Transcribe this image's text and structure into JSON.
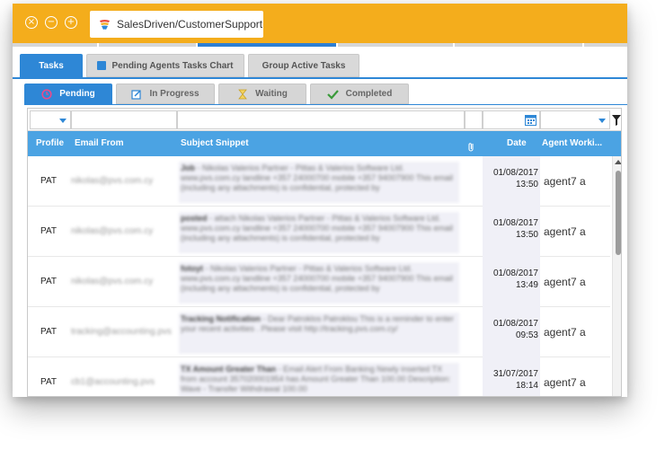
{
  "window": {
    "tab_title": "SalesDriven/CustomerSupport",
    "accent_color": "#f4ad1c",
    "controls": [
      "close-icon",
      "minimize-icon",
      "maximize-icon"
    ]
  },
  "main_tabs": [
    {
      "label": "Tasks",
      "active": true
    },
    {
      "label": "Pending Agents Tasks Chart",
      "active": false,
      "icon": "chart-icon"
    },
    {
      "label": "Group Active Tasks",
      "active": false
    }
  ],
  "status_tabs": [
    {
      "label": "Pending",
      "active": true,
      "icon": "clock-icon"
    },
    {
      "label": "In Progress",
      "active": false,
      "icon": "edit-icon"
    },
    {
      "label": "Waiting",
      "active": false,
      "icon": "hourglass-icon"
    },
    {
      "label": "Completed",
      "active": false,
      "icon": "check-icon"
    }
  ],
  "grid": {
    "columns": [
      "Profile",
      "Email From",
      "Subject Snippet",
      "attachment-icon",
      "Date",
      "Agent Worki..."
    ],
    "rows": [
      {
        "profile": "PAT",
        "email": "nikolas@pvs.com.cy",
        "subject": "Job",
        "snippet": " - Nikolas Valerios Partner - Pittas & Valerios Software Ltd. www.pvs.com.cy landline +357 24000700 mobile +357 94007900 This email (including any attachments) is confidential, protected by",
        "date": "01/08/2017",
        "time": "13:50",
        "agent": "agent7 a"
      },
      {
        "profile": "PAT",
        "email": "nikolas@pvs.com.cy",
        "subject": "posted",
        "snippet": " - attach Nikolas Valerios Partner - Pittas & Valerios Software Ltd. www.pvs.com.cy landline +357 24000700 mobile +357 94007900 This email (including any attachments) is confidential, protected by",
        "date": "01/08/2017",
        "time": "13:50",
        "agent": "agent7 a"
      },
      {
        "profile": "PAT",
        "email": "nikolas@pvs.com.cy",
        "subject": "fotoyt",
        "snippet": " - Nikolas Valerios Partner - Pittas & Valerios Software Ltd. www.pvs.com.cy landline +357 24000700 mobile +357 94007900 This email (including any attachments) is confidential, protected by",
        "date": "01/08/2017",
        "time": "13:49",
        "agent": "agent7 a"
      },
      {
        "profile": "PAT",
        "email": "tracking@accounting.pvs",
        "subject": "Tracking Notification",
        "snippet": " - Dear Patroklos Patroklou This is a reminder to enter your recent activities . Please visit http://tracking.pvs.com.cy/",
        "date": "01/08/2017",
        "time": "09:53",
        "agent": "agent7 a"
      },
      {
        "profile": "PAT",
        "email": "cb1@accounting.pvs",
        "subject": "TX Amount Greater Than",
        "snippet": " - Email Alert From Banking Newly inserted TX from account 357020001954 has Amount Greater Than 100.00 Description: Wave - Transfer Withdrawal 100.00",
        "date": "31/07/2017",
        "time": "18:14",
        "agent": "agent7 a"
      }
    ]
  }
}
